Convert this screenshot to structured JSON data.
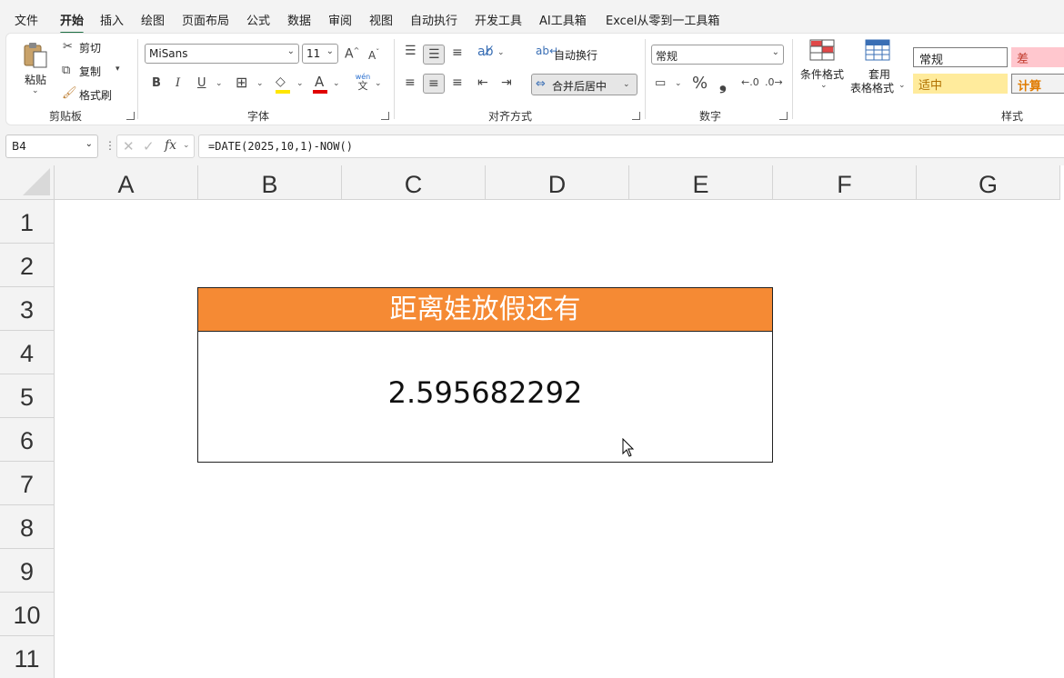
{
  "menu": {
    "tabs": [
      "文件",
      "开始",
      "插入",
      "绘图",
      "页面布局",
      "公式",
      "数据",
      "审阅",
      "视图",
      "自动执行",
      "开发工具",
      "AI工具箱",
      "Excel从零到一工具箱"
    ],
    "active": "开始"
  },
  "ribbon": {
    "clipboard": {
      "paste": "粘贴",
      "cut": "剪切",
      "copy": "复制",
      "format_painter": "格式刷",
      "label": "剪贴板"
    },
    "font": {
      "name": "MiSans",
      "size": "11",
      "grow": "A",
      "shrink": "A",
      "bold": "B",
      "italic": "I",
      "underline": "U",
      "font_color_glyph": "A",
      "wen": "wén",
      "wen_char": "文",
      "label": "字体"
    },
    "alignment": {
      "wrap_text": "自动换行",
      "merge_center": "合并后居中",
      "label": "对齐方式"
    },
    "number": {
      "format": "常规",
      "percent": "%",
      "comma": "❟",
      "label": "数字"
    },
    "styles": {
      "conditional": "条件格式",
      "table_line1": "套用",
      "table_line2": "表格格式",
      "normal": "常规",
      "bad": "差",
      "neutral": "适中",
      "calc": "计算",
      "label": "样式"
    }
  },
  "formula_bar": {
    "name_box": "B4",
    "formula": "=DATE(2025,10,1)-NOW()"
  },
  "columns": [
    "A",
    "B",
    "C",
    "D",
    "E",
    "F",
    "G"
  ],
  "rows": [
    "1",
    "2",
    "3",
    "4",
    "5",
    "6",
    "7",
    "8",
    "9",
    "10",
    "11"
  ],
  "sheet": {
    "banner_text": "距离娃放假还有",
    "value": "2.595682292"
  },
  "colors": {
    "accent": "#1e7145",
    "banner": "#f58a34"
  }
}
